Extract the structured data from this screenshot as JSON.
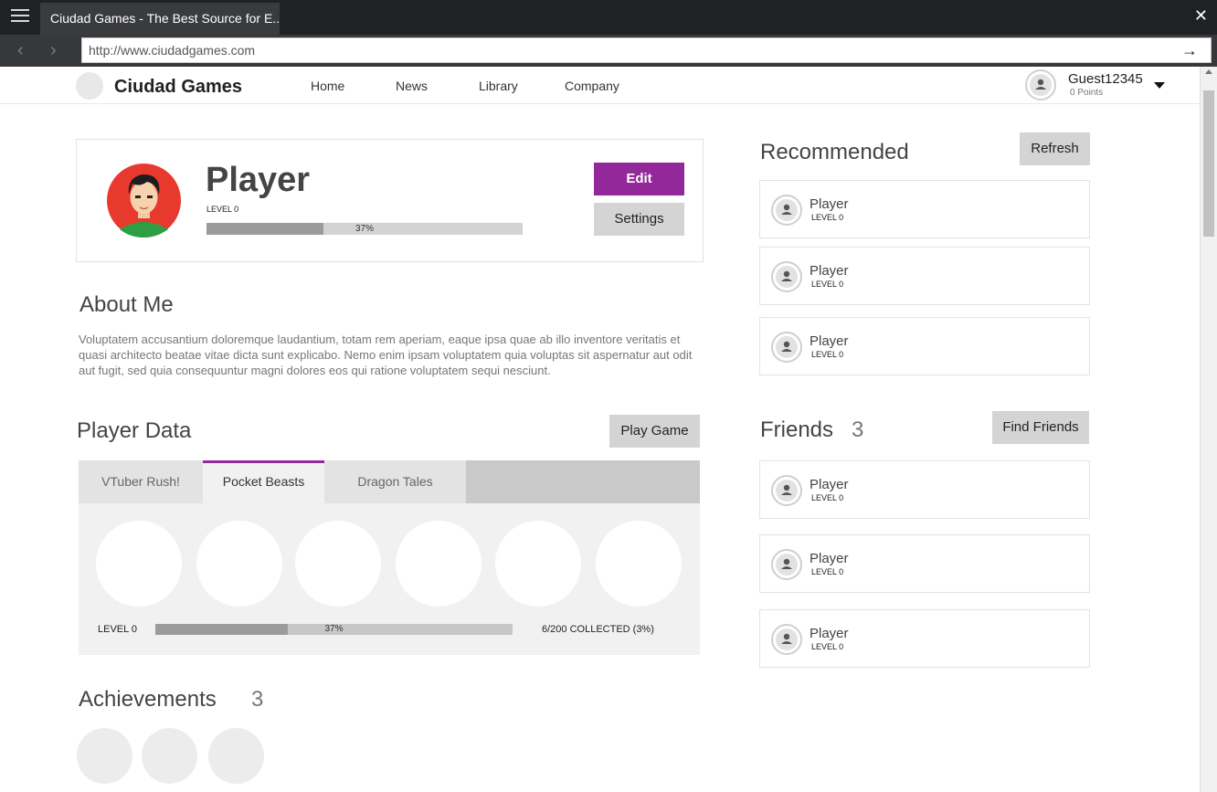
{
  "browser": {
    "tab_title": "Ciudad Games - The Best Source for E...",
    "url": "http://www.ciudadgames.com",
    "back_symbol": "‹",
    "forward_symbol": "›",
    "go_symbol": "→",
    "close_symbol": "✕"
  },
  "header": {
    "brand": "Ciudad Games",
    "nav": [
      "Home",
      "News",
      "Library",
      "Company"
    ],
    "user": {
      "name": "Guest12345",
      "points": "0 Points"
    }
  },
  "profile": {
    "name": "Player",
    "level": "LEVEL 0",
    "progress_label": "37%",
    "progress_fraction": 0.37,
    "edit_label": "Edit",
    "settings_label": "Settings"
  },
  "about": {
    "title": "About Me",
    "text": "Voluptatem accusantium doloremque laudantium, totam rem aperiam, eaque ipsa quae ab illo inventore veritatis et quasi architecto beatae vitae dicta sunt explicabo. Nemo enim ipsam voluptatem quia voluptas sit aspernatur aut odit aut fugit, sed quia consequuntur magni dolores eos qui ratione voluptatem sequi nesciunt."
  },
  "player_data": {
    "title": "Player Data",
    "play_label": "Play Game",
    "tabs": [
      "VTuber Rush!",
      "Pocket Beasts",
      "Dragon Tales"
    ],
    "active_tab": 1,
    "level": "LEVEL 0",
    "progress_label": "37%",
    "progress_fraction": 0.37,
    "collected": "6/200 COLLECTED (3%)"
  },
  "achievements": {
    "title": "Achievements",
    "count": "3"
  },
  "recommended": {
    "title": "Recommended",
    "refresh_label": "Refresh",
    "players": [
      {
        "name": "Player",
        "level": "LEVEL 0"
      },
      {
        "name": "Player",
        "level": "LEVEL 0"
      },
      {
        "name": "Player",
        "level": "LEVEL 0"
      }
    ]
  },
  "friends": {
    "title": "Friends",
    "count": "3",
    "find_label": "Find Friends",
    "players": [
      {
        "name": "Player",
        "level": "LEVEL 0"
      },
      {
        "name": "Player",
        "level": "LEVEL 0"
      },
      {
        "name": "Player",
        "level": "LEVEL 0"
      }
    ]
  },
  "colors": {
    "accent": "#93289a",
    "button_grey": "#d4d4d4",
    "chrome_dark": "#202124"
  },
  "icons": [
    "hamburger-menu-icon",
    "close-icon",
    "back-arrow-icon",
    "forward-arrow-icon",
    "go-arrow-icon",
    "user-avatar-icon",
    "chevron-down-icon"
  ]
}
